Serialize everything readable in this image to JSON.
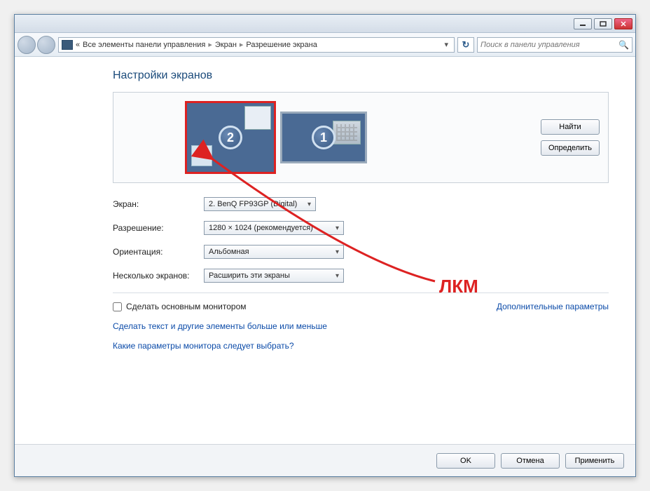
{
  "breadcrumb": {
    "prefix": "«",
    "seg1": "Все элементы панели управления",
    "seg2": "Экран",
    "seg3": "Разрешение экрана"
  },
  "search": {
    "placeholder": "Поиск в панели управления"
  },
  "heading": "Настройки экранов",
  "monitors": {
    "m2": "2",
    "m1": "1"
  },
  "buttons": {
    "find": "Найти",
    "detect": "Определить"
  },
  "labels": {
    "display": "Экран:",
    "resolution": "Разрешение:",
    "orientation": "Ориентация:",
    "multiple": "Несколько экранов:"
  },
  "values": {
    "display": "2. BenQ FP93GP (Digital)",
    "resolution": "1280 × 1024 (рекомендуется)",
    "orientation": "Альбомная",
    "multiple": "Расширить эти экраны"
  },
  "checkbox": "Сделать основным монитором",
  "advanced": "Дополнительные параметры",
  "links": {
    "textsize": "Сделать текст и другие элементы больше или меньше",
    "help": "Какие параметры монитора следует выбрать?"
  },
  "footer": {
    "ok": "OK",
    "cancel": "Отмена",
    "apply": "Применить"
  },
  "annotation": "ЛКМ"
}
